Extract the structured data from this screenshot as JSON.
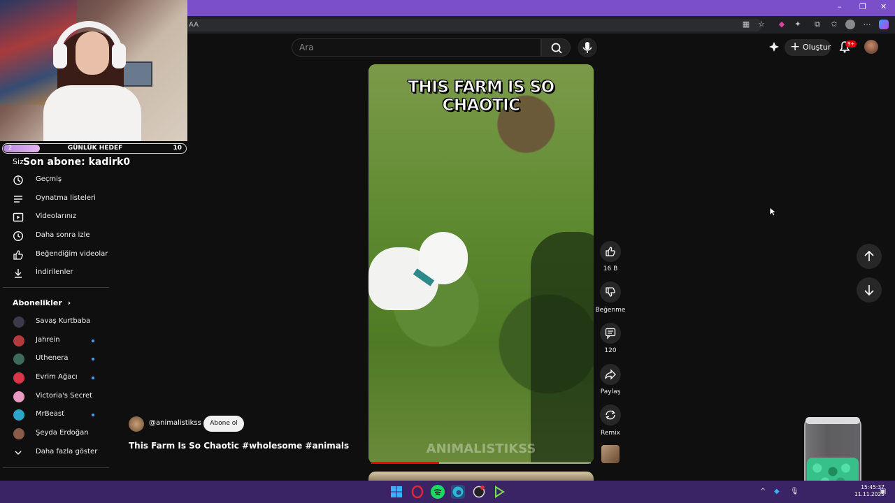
{
  "header": {
    "search_placeholder": "Ara",
    "create_label": "Oluştur",
    "notification_badge": "9+",
    "address_text": "AA"
  },
  "overlay": {
    "goal_current": "2",
    "goal_label": "GÜNLÜK HEDEF",
    "goal_target": "10",
    "goal_progress_fraction": 0.2,
    "last_subscriber": "Son abone: kadirk0",
    "sidebar_partial_heading": "Siz"
  },
  "sidebar": {
    "you_items": [
      {
        "label": "Geçmiş",
        "icon": "history-icon"
      },
      {
        "label": "Oynatma listeleri",
        "icon": "playlist-icon"
      },
      {
        "label": "Videolarınız",
        "icon": "your-videos-icon"
      },
      {
        "label": "Daha sonra izle",
        "icon": "watch-later-icon"
      },
      {
        "label": "Beğendiğim videolar",
        "icon": "like-icon"
      },
      {
        "label": "İndirilenler",
        "icon": "download-icon"
      }
    ],
    "subscriptions_heading": "Abonelikler",
    "subscriptions": [
      {
        "label": "Savaş Kurtbaba",
        "new": false,
        "color": "#3a3a4a"
      },
      {
        "label": "Jahrein",
        "new": true,
        "color": "#b23b3b"
      },
      {
        "label": "Uthenera",
        "new": true,
        "color": "#3d6a5a"
      },
      {
        "label": "Evrim Ağacı",
        "new": true,
        "color": "#d9364a"
      },
      {
        "label": "Victoria's Secret",
        "new": false,
        "color": "#e89ac0"
      },
      {
        "label": "MrBeast",
        "new": true,
        "color": "#2aa6c9"
      },
      {
        "label": "Şeyda Erdoğan",
        "new": false,
        "color": "#8a5a4a"
      }
    ],
    "show_more_label": "Daha fazla göster"
  },
  "video": {
    "caption": "THIS FARM IS SO CHAOTIC",
    "watermark": "ANIMALISTIKSS",
    "progress_fraction": 0.31,
    "channel": "@animalistikss",
    "subscribe_label": "Abone ol",
    "title": "This Farm Is So Chaotic #wholesome #animals"
  },
  "actions": {
    "likes": "16 B",
    "dislike_label": "Beğenme",
    "comments": "120",
    "share_label": "Paylaş",
    "remix_label": "Remix"
  },
  "taskbar": {
    "clock_time": "15:45:37",
    "clock_date": "11.11.2025"
  },
  "colors": {
    "titlebar": "#7b4fc9",
    "taskbar": "#3a2466",
    "progress": "#ff0000",
    "new_dot": "#3ea6ff"
  }
}
